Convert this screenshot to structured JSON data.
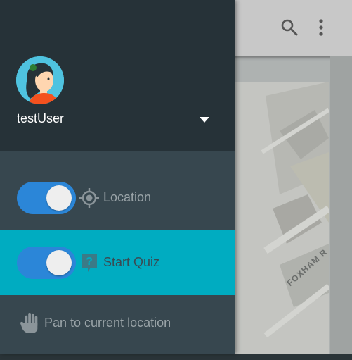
{
  "user": {
    "name": "testUser"
  },
  "menu": {
    "location": {
      "label": "Location",
      "enabled": true
    },
    "start_quiz": {
      "label": "Start Quiz",
      "enabled": true
    },
    "pan": {
      "label": "Pan to current location"
    }
  },
  "map": {
    "street_label": "FOXHAM R"
  },
  "colors": {
    "drawer_header": "#263238",
    "drawer_body": "#37474f",
    "active_row": "#00acc1",
    "toggle_track": "#2b86d8",
    "toggle_knob": "#eeeeee"
  }
}
